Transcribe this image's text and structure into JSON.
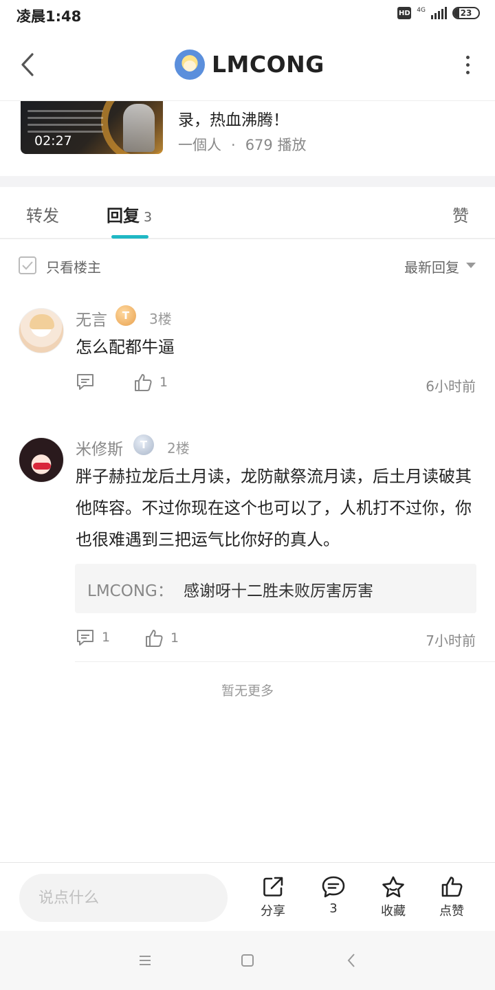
{
  "status_bar": {
    "time": "凌晨1:48",
    "hd_label": "HD",
    "network_label": "4G",
    "battery_level": "23",
    "battery_fraction": 0.23
  },
  "header": {
    "title": "LMCONG",
    "back_icon": "chevron-left-icon",
    "more_icon": "more-vertical-icon"
  },
  "video": {
    "duration": "02:27",
    "title": "录，热血沸腾！",
    "author": "一個人",
    "separator": "·",
    "plays": "679 播放"
  },
  "tabs": {
    "repost": "转发",
    "reply": "回复",
    "reply_count": "3",
    "like": "赞",
    "active_color": "#1fb8c4"
  },
  "filter": {
    "only_owner": "只看楼主",
    "sort": "最新回复"
  },
  "comments": [
    {
      "username": "无言",
      "level_badge": "T",
      "floor": "3楼",
      "text": "怎么配都牛逼",
      "comment_count": "",
      "like_count": "1",
      "time": "6小时前"
    },
    {
      "username": "米修斯",
      "level_badge": "T",
      "floor": "2楼",
      "text": "胖子赫拉龙后土月读，龙防献祭流月读，后土月读破其他阵容。不过你现在这个也可以了，人机打不过你，你也很难遇到三把运气比你好的真人。",
      "reply": {
        "author": "LMCONG：",
        "text": "感谢呀十二胜未败厉害厉害"
      },
      "comment_count": "1",
      "like_count": "1",
      "time": "7小时前"
    }
  ],
  "no_more": "暂无更多",
  "bottom_bar": {
    "input_placeholder": "说点什么",
    "share": "分享",
    "comment_count": "3",
    "favorite": "收藏",
    "like": "点赞"
  }
}
